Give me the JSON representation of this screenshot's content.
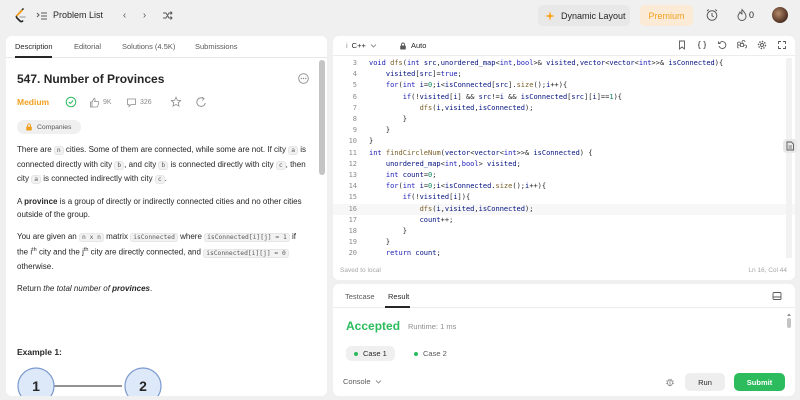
{
  "topbar": {
    "problem_list_label": "Problem List",
    "prev_symbol": "‹",
    "next_symbol": "›",
    "dynamic_layout_label": "Dynamic Layout",
    "premium_label": "Premium",
    "streak_count": "0",
    "brand_color": "#ffa116"
  },
  "left_tabs": {
    "description": "Description",
    "editorial": "Editorial",
    "solutions": "Solutions (4.5K)",
    "submissions": "Submissions"
  },
  "problem": {
    "title": "547. Number of Provinces",
    "difficulty": "Medium",
    "likes": "9K",
    "comments": "326",
    "companies_label": "Companies",
    "p1_a": "There are ",
    "p1_n": "n",
    "p1_b": " cities. Some of them are connected, while some are not. If city ",
    "p1_a2": "a",
    "p1_c": " is connected directly with city ",
    "p1_b2": "b",
    "p1_d": ", and city ",
    "p1_b3": "b",
    "p1_e": " is connected directly with city ",
    "p1_c2": "c",
    "p1_f": ", then city ",
    "p1_a3": "a",
    "p1_g": " is connected indirectly with city ",
    "p1_c3": "c",
    "p1_h": ".",
    "p2_a": "A ",
    "p2_b": "province",
    "p2_c": " is a group of directly or indirectly connected cities and no other cities outside of the group.",
    "p3_a": "You are given an ",
    "p3_code1": "n x n",
    "p3_b": " matrix ",
    "p3_code2": "isConnected",
    "p3_c": " where ",
    "p3_code3": "isConnected[i][j] = 1",
    "p3_d": " if the i",
    "p3_sup1": "th",
    "p3_e": " city and the j",
    "p3_sup2": "th",
    "p3_f": " city are directly connected, and ",
    "p3_code4": "isConnected[i][j] = 0",
    "p3_g": " otherwise.",
    "p4_a": "Return ",
    "p4_b": "the total number of ",
    "p4_c": "provinces",
    "p4_d": ".",
    "example_title": "Example 1:",
    "node_1": "1",
    "node_2": "2"
  },
  "editor": {
    "language": "C++",
    "auto_label": "Auto",
    "saved_label": "Saved to local",
    "cursor_pos": "Ln 16, Col 44"
  },
  "code_lines": [
    {
      "num": "3"
    },
    {
      "num": "4"
    },
    {
      "num": "5"
    },
    {
      "num": "6"
    },
    {
      "num": "7"
    },
    {
      "num": "8"
    },
    {
      "num": "9"
    },
    {
      "num": "10"
    },
    {
      "num": "11"
    },
    {
      "num": "12"
    },
    {
      "num": "13"
    },
    {
      "num": "14"
    },
    {
      "num": "15"
    },
    {
      "num": "16"
    },
    {
      "num": "17"
    },
    {
      "num": "18"
    },
    {
      "num": "19"
    },
    {
      "num": "20"
    }
  ],
  "result": {
    "tab_testcase": "Testcase",
    "tab_result": "Result",
    "status": "Accepted",
    "runtime": "Runtime: 1 ms",
    "case1": "Case 1",
    "case2": "Case 2",
    "console_label": "Console",
    "run_label": "Run",
    "submit_label": "Submit",
    "accepted_color": "#2cbb5d"
  }
}
